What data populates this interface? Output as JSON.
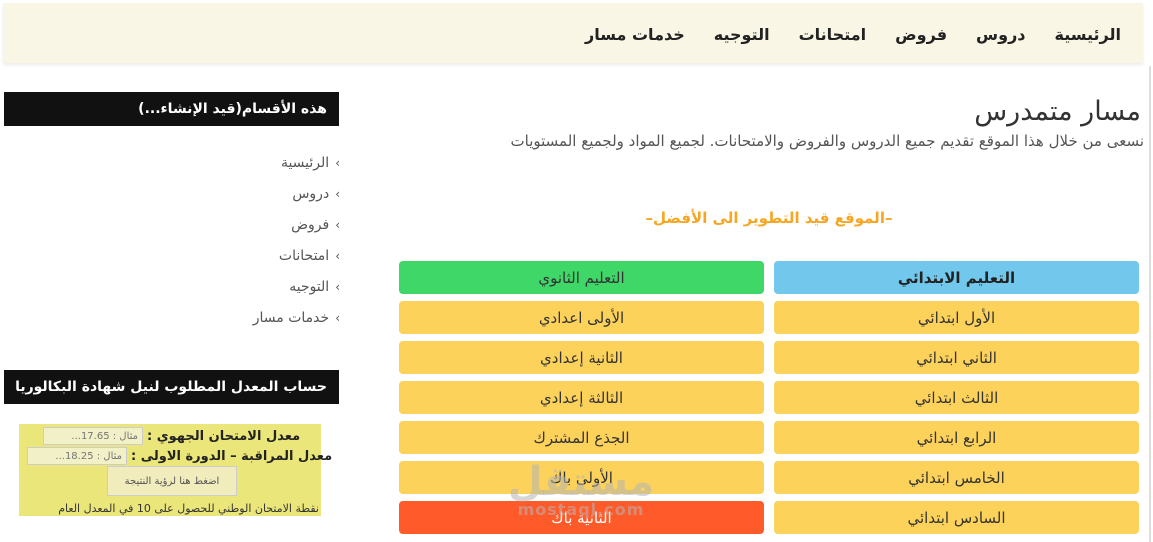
{
  "nav": {
    "items": [
      "الرئيسية",
      "دروس",
      "فروض",
      "امتحانات",
      "التوجيه",
      "خدمات مسار"
    ]
  },
  "hero": {
    "title": "مسار متمدرس",
    "subtitle": "نسعى من خلال هذا الموقع تقديم جميع الدروس والفروض والامتحانات. لجميع المواد ولجميع المستويات",
    "notice": "–الموقع قيد التطوير الى الأفضل–"
  },
  "levels": {
    "primary": {
      "heading": "التعليم الابتدائي",
      "items": [
        "الأول ابتدائي",
        "الثاني ابتدائي",
        "الثالث ابتدائي",
        "الرابع ابتدائي",
        "الخامس ابتدائي",
        "السادس ابتدائي"
      ]
    },
    "secondary": {
      "heading": "التعليم الثانوي",
      "items": [
        "الأولى اعدادي",
        "الثانية إعدادي",
        "الثالثة إعدادي",
        "الجذع المشترك",
        "الأولى باك",
        "الثانية باك"
      ]
    }
  },
  "colors": {
    "primary_heading": "#72c8ec",
    "secondary_heading": "#3ed768",
    "level_button": "#fcd25a",
    "highlight_button": "#ff5b2a",
    "notice": "#f5a623"
  },
  "watermark": {
    "main": "مستقل",
    "sub": "mostaql.com"
  },
  "sidebar": {
    "sections_heading": "هذه الأقسام(قيد الإنشاء...)",
    "chevron": "‹",
    "items": [
      "الرئيسية",
      "دروس",
      "فروض",
      "امتحانات",
      "التوجيه",
      "خدمات مسار"
    ],
    "calc_heading": "حساب المعدل المطلوب لنيل شهادة البكالوريا"
  },
  "calculator": {
    "regional_label": "معدل الامتحان الجهوي :",
    "regional_placeholder": "مثال : 17.65...",
    "continuous_label": "معدل المراقبة – الدورة الاولى :",
    "continuous_placeholder": "مثال : 18.25...",
    "submit_label": "اضغط هنا لرؤية النتيجة",
    "note": "نقطة الامتحان الوطني للحصول على 10 في المعدل العام"
  }
}
